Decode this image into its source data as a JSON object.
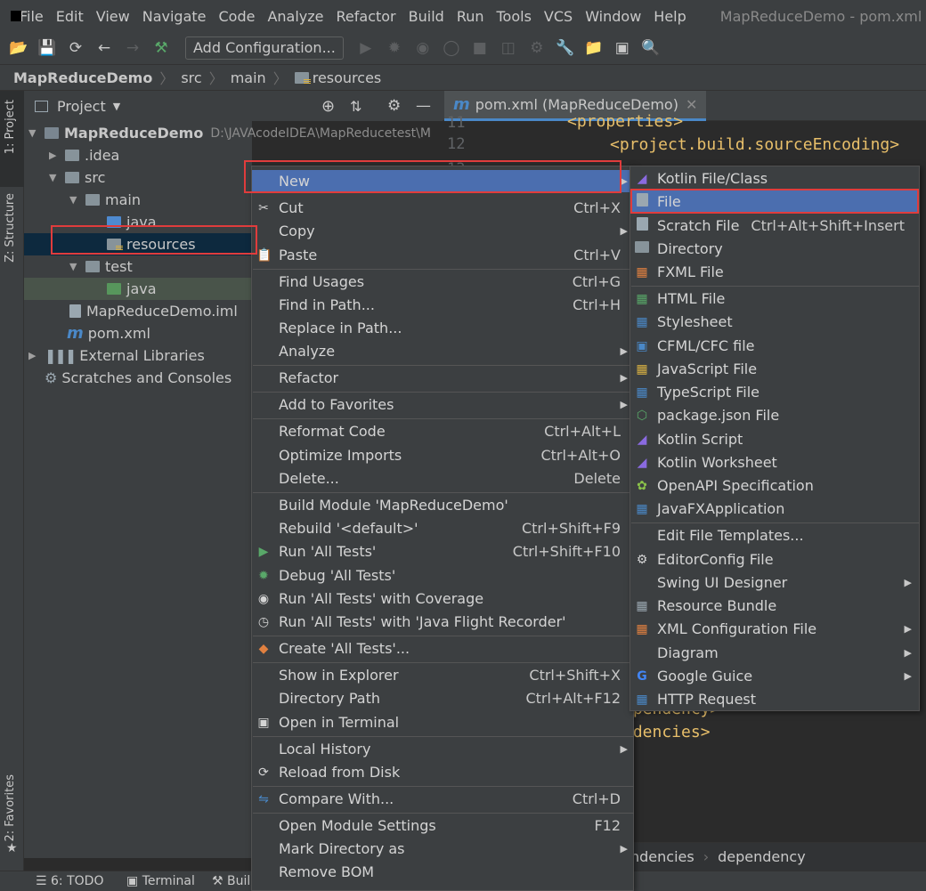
{
  "menubar": {
    "items": [
      "File",
      "Edit",
      "View",
      "Navigate",
      "Code",
      "Analyze",
      "Refactor",
      "Build",
      "Run",
      "Tools",
      "VCS",
      "Window",
      "Help"
    ],
    "window_title": "MapReduceDemo - pom.xml (M"
  },
  "toolbar": {
    "add_config": "Add Configuration..."
  },
  "breadcrumb": {
    "items": [
      "MapReduceDemo",
      "src",
      "main",
      "resources"
    ]
  },
  "side_tabs": {
    "project": "1: Project",
    "structure": "Z: Structure",
    "favorites": "2: Favorites"
  },
  "project_panel": {
    "title": "Project"
  },
  "tree": {
    "root": "MapReduceDemo",
    "root_path": "D:\\JAVAcodeIDEA\\MapReducetest\\M",
    "idea": ".idea",
    "src": "src",
    "main": "main",
    "java": "java",
    "resources": "resources",
    "test": "test",
    "test_java": "java",
    "iml": "MapReduceDemo.iml",
    "pom": "pom.xml",
    "ext_libs": "External Libraries",
    "scratches": "Scratches and Consoles"
  },
  "editor": {
    "tab_label": "pom.xml (MapReduceDemo)",
    "tab_icon": "m",
    "lines": [
      "11",
      "12",
      "13"
    ],
    "code": [
      "<properties>",
      "<project.build.sourceEncoding>",
      "ependency>",
      "ndencies>"
    ],
    "bread": [
      "ndencies",
      "dependency"
    ]
  },
  "context_menu": [
    {
      "label": "New",
      "shortcut": "",
      "icon": "",
      "sub": true
    },
    {
      "label": "Cut",
      "shortcut": "Ctrl+X",
      "icon": "scissors-icon"
    },
    {
      "label": "Copy",
      "shortcut": "",
      "icon": "",
      "sub": true
    },
    {
      "label": "Paste",
      "shortcut": "Ctrl+V",
      "icon": "clipboard-icon"
    },
    {
      "label": "Find Usages",
      "shortcut": "Ctrl+G"
    },
    {
      "label": "Find in Path...",
      "shortcut": "Ctrl+H"
    },
    {
      "label": "Replace in Path...",
      "shortcut": ""
    },
    {
      "label": "Analyze",
      "shortcut": "",
      "sub": true
    },
    {
      "label": "Refactor",
      "shortcut": "",
      "sub": true
    },
    {
      "label": "Add to Favorites",
      "shortcut": "",
      "sub": true
    },
    {
      "label": "Reformat Code",
      "shortcut": "Ctrl+Alt+L"
    },
    {
      "label": "Optimize Imports",
      "shortcut": "Ctrl+Alt+O"
    },
    {
      "label": "Delete...",
      "shortcut": "Delete"
    },
    {
      "label": "Build Module 'MapReduceDemo'",
      "shortcut": ""
    },
    {
      "label": "Rebuild '<default>'",
      "shortcut": "Ctrl+Shift+F9"
    },
    {
      "label": "Run 'All Tests'",
      "shortcut": "Ctrl+Shift+F10",
      "icon": "run-icon"
    },
    {
      "label": "Debug 'All Tests'",
      "shortcut": "",
      "icon": "debug-icon"
    },
    {
      "label": "Run 'All Tests' with Coverage",
      "shortcut": "",
      "icon": "coverage-icon"
    },
    {
      "label": "Run 'All Tests' with 'Java Flight Recorder'",
      "shortcut": "",
      "icon": "profiler-icon"
    },
    {
      "label": "Create 'All Tests'...",
      "shortcut": "",
      "icon": "create-test-icon"
    },
    {
      "label": "Show in Explorer",
      "shortcut": "Ctrl+Shift+X"
    },
    {
      "label": "Directory Path",
      "shortcut": "Ctrl+Alt+F12"
    },
    {
      "label": "Open in Terminal",
      "shortcut": "",
      "icon": "terminal-icon"
    },
    {
      "label": "Local History",
      "shortcut": "",
      "sub": true
    },
    {
      "label": "Reload from Disk",
      "shortcut": "",
      "icon": "reload-icon"
    },
    {
      "label": "Compare With...",
      "shortcut": "Ctrl+D",
      "icon": "compare-icon"
    },
    {
      "label": "Open Module Settings",
      "shortcut": "F12"
    },
    {
      "label": "Mark Directory as",
      "shortcut": "",
      "sub": true
    },
    {
      "label": "Remove BOM",
      "shortcut": ""
    }
  ],
  "new_submenu": [
    {
      "label": "Kotlin File/Class",
      "shortcut": ""
    },
    {
      "label": "File",
      "shortcut": ""
    },
    {
      "label": "Scratch File",
      "shortcut": "Ctrl+Alt+Shift+Insert"
    },
    {
      "label": "Directory",
      "shortcut": ""
    },
    {
      "label": "FXML File",
      "shortcut": ""
    },
    {
      "label": "HTML File",
      "shortcut": ""
    },
    {
      "label": "Stylesheet",
      "shortcut": ""
    },
    {
      "label": "CFML/CFC file",
      "shortcut": ""
    },
    {
      "label": "JavaScript File",
      "shortcut": ""
    },
    {
      "label": "TypeScript File",
      "shortcut": ""
    },
    {
      "label": "package.json File",
      "shortcut": ""
    },
    {
      "label": "Kotlin Script",
      "shortcut": ""
    },
    {
      "label": "Kotlin Worksheet",
      "shortcut": ""
    },
    {
      "label": "OpenAPI Specification",
      "shortcut": ""
    },
    {
      "label": "JavaFXApplication",
      "shortcut": ""
    },
    {
      "label": "Edit File Templates...",
      "shortcut": ""
    },
    {
      "label": "EditorConfig File",
      "shortcut": ""
    },
    {
      "label": "Swing UI Designer",
      "shortcut": "",
      "sub": true
    },
    {
      "label": "Resource Bundle",
      "shortcut": ""
    },
    {
      "label": "XML Configuration File",
      "shortcut": "",
      "sub": true
    },
    {
      "label": "Diagram",
      "shortcut": "",
      "sub": true
    },
    {
      "label": "Google Guice",
      "shortcut": "",
      "sub": true
    },
    {
      "label": "HTTP Request",
      "shortcut": ""
    }
  ],
  "statusbar": {
    "todo": "6: TODO",
    "terminal": "Terminal",
    "build": "Buil"
  }
}
